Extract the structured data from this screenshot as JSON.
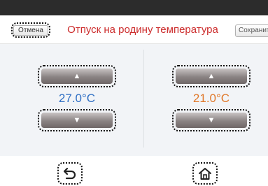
{
  "header": {
    "cancel_label": "Отмена",
    "title": "Отпуск на родину температура",
    "save_label": "Сохранить"
  },
  "controls": {
    "left": {
      "value": "27.0°C",
      "color": "#2f6fc4"
    },
    "right": {
      "value": "21.0°C",
      "color": "#e0782a"
    }
  },
  "icons": {
    "up": "triangle-up",
    "down": "triangle-down",
    "back": "back-arrow-icon",
    "home": "home-icon"
  },
  "colors": {
    "title": "#cc2b2b",
    "topbar": "#2c2c2c",
    "panel": "#f2f4f7"
  }
}
